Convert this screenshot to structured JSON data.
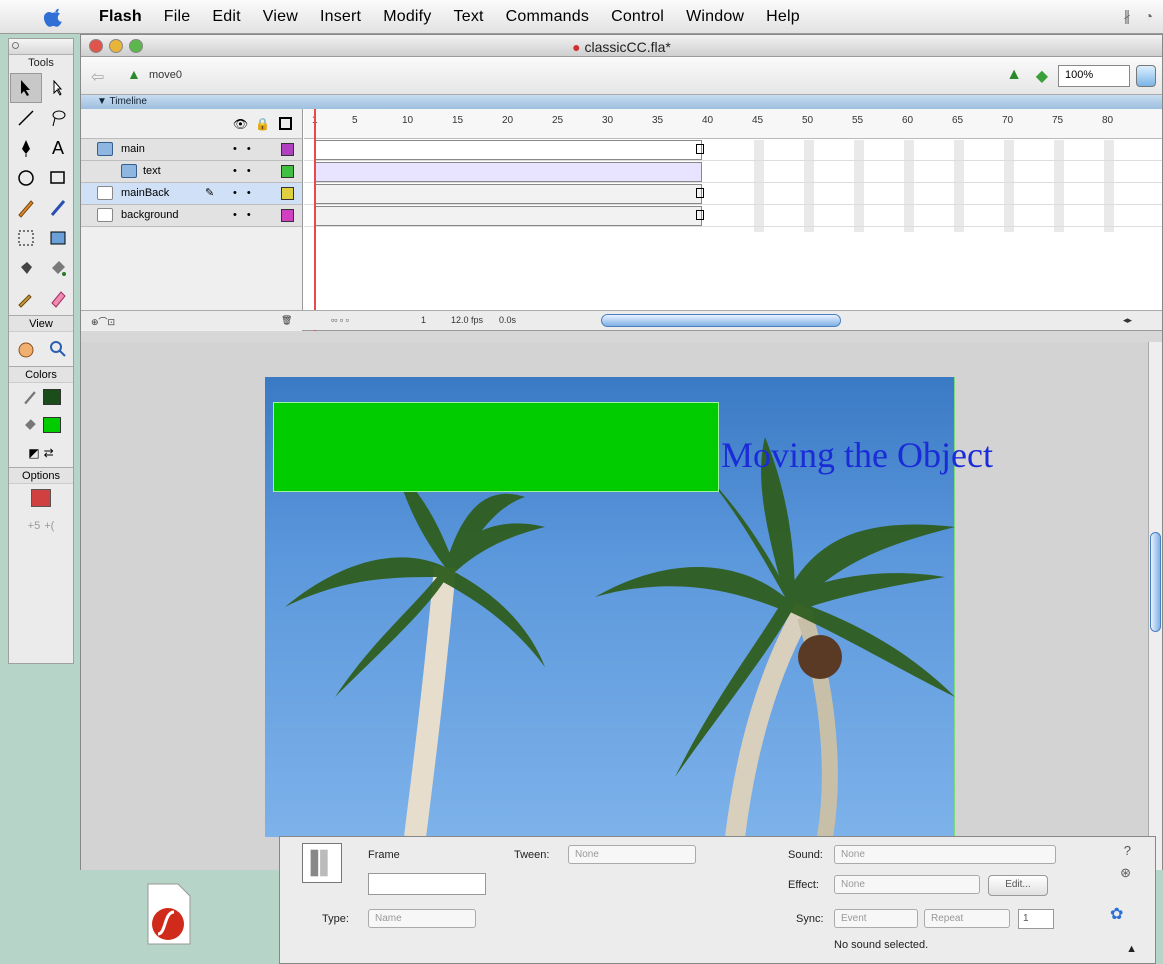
{
  "menubar": {
    "items": [
      "Flash",
      "File",
      "Edit",
      "View",
      "Insert",
      "Modify",
      "Text",
      "Commands",
      "Control",
      "Window",
      "Help"
    ]
  },
  "tools": {
    "title": "Tools",
    "view_label": "View",
    "colors_label": "Colors",
    "options_label": "Options",
    "stroke_color": "#1a4d1a",
    "fill_color": "#00cc00"
  },
  "document": {
    "title": "classicCC.fla*",
    "scene": "move0",
    "zoom": "100%",
    "timeline_label": "▼ Timeline"
  },
  "timeline": {
    "layers": [
      {
        "name": "main",
        "color": "#b040c0",
        "selected": false
      },
      {
        "name": "text",
        "color": "#40c040",
        "selected": false
      },
      {
        "name": "mainBack",
        "color": "#e0d040",
        "selected": true
      },
      {
        "name": "background",
        "color": "#d040c0",
        "selected": false
      }
    ],
    "ruler": [
      "1",
      "5",
      "10",
      "15",
      "20",
      "25",
      "30",
      "35",
      "40",
      "45",
      "50",
      "55",
      "60",
      "65",
      "70",
      "75",
      "80"
    ],
    "current_frame": "1",
    "fps": "12.0 fps",
    "elapsed": "0.0s"
  },
  "stage": {
    "heading": "Moving the Object",
    "box_color": "#00cc00"
  },
  "properties": {
    "frame_label": "Frame",
    "tween_label": "Tween:",
    "tween_value": "None",
    "type_label": "Type:",
    "type_value": "Name",
    "sound_label": "Sound:",
    "sound_value": "None",
    "effect_label": "Effect:",
    "effect_value": "None",
    "edit_button": "Edit...",
    "sync_label": "Sync:",
    "sync_value": "Event",
    "repeat_value": "Repeat",
    "repeat_count": "1",
    "status": "No sound selected."
  }
}
